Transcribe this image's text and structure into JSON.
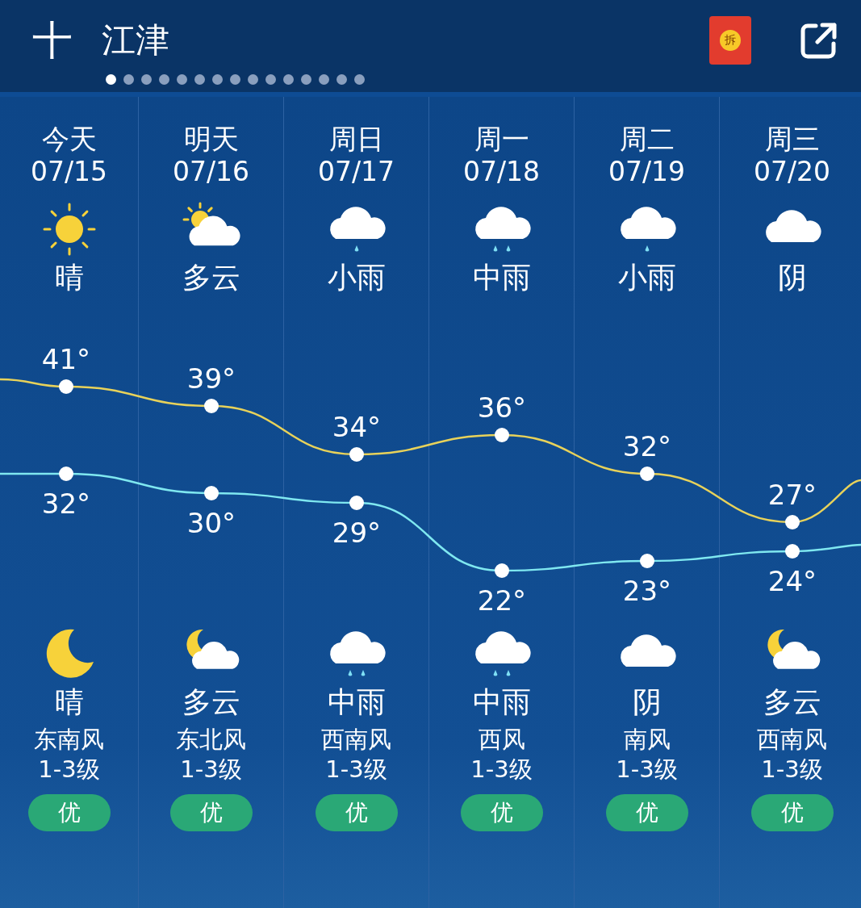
{
  "header": {
    "add_label": "十",
    "city": "江津",
    "envelope_label": "拆",
    "pages": [
      {
        "selected": true
      },
      {
        "selected": false
      },
      {
        "selected": false
      },
      {
        "selected": false
      },
      {
        "selected": false
      },
      {
        "selected": false
      },
      {
        "selected": false
      },
      {
        "selected": false
      },
      {
        "selected": false
      },
      {
        "selected": false
      },
      {
        "selected": false
      },
      {
        "selected": false
      },
      {
        "selected": false
      },
      {
        "selected": false
      },
      {
        "selected": false
      }
    ]
  },
  "days": [
    {
      "day": "今天",
      "date": "07/15",
      "day_weather": {
        "kind": "sun",
        "text": "晴"
      },
      "night_weather": {
        "kind": "moon",
        "text": "晴"
      },
      "wind": "东南风",
      "wind_level": "1-3级",
      "aqi": "优"
    },
    {
      "day": "明天",
      "date": "07/16",
      "day_weather": {
        "kind": "sun_cloud",
        "text": "多云"
      },
      "night_weather": {
        "kind": "moon_cloud",
        "text": "多云"
      },
      "wind": "东北风",
      "wind_level": "1-3级",
      "aqi": "优"
    },
    {
      "day": "周日",
      "date": "07/17",
      "day_weather": {
        "kind": "rain_light",
        "text": "小雨"
      },
      "night_weather": {
        "kind": "rain_moderate",
        "text": "中雨"
      },
      "wind": "西南风",
      "wind_level": "1-3级",
      "aqi": "优"
    },
    {
      "day": "周一",
      "date": "07/18",
      "day_weather": {
        "kind": "rain_moderate",
        "text": "中雨"
      },
      "night_weather": {
        "kind": "rain_moderate",
        "text": "中雨"
      },
      "wind": "西风",
      "wind_level": "1-3级",
      "aqi": "优"
    },
    {
      "day": "周二",
      "date": "07/19",
      "day_weather": {
        "kind": "rain_light",
        "text": "小雨"
      },
      "night_weather": {
        "kind": "cloud",
        "text": "阴"
      },
      "wind": "南风",
      "wind_level": "1-3级",
      "aqi": "优"
    },
    {
      "day": "周三",
      "date": "07/20",
      "day_weather": {
        "kind": "cloud",
        "text": "阴"
      },
      "night_weather": {
        "kind": "moon_cloud",
        "text": "多云"
      },
      "wind": "西南风",
      "wind_level": "1-3级",
      "aqi": "优"
    }
  ],
  "chart_data": {
    "type": "line",
    "data_labels": true,
    "series": [
      {
        "color": "#e8d25a",
        "marker": "circle",
        "values": [
          41,
          39,
          34,
          36,
          32,
          27
        ],
        "value_labels": [
          "41°",
          "39°",
          "34°",
          "36°",
          "32°",
          "27°"
        ]
      },
      {
        "color": "#7fe8f0",
        "marker": "circle",
        "values": [
          32,
          30,
          29,
          22,
          23,
          24
        ],
        "value_labels": [
          "32°",
          "30°",
          "29°",
          "22°",
          "23°",
          "24°"
        ]
      }
    ]
  }
}
